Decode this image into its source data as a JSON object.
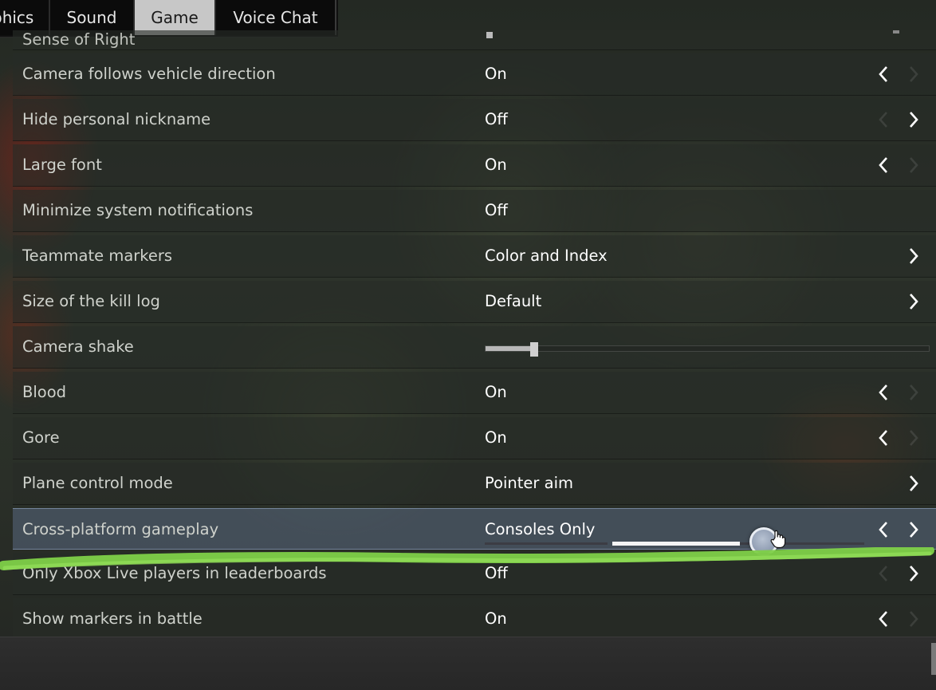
{
  "tabs": [
    {
      "label": "phics"
    },
    {
      "label": "Sound"
    },
    {
      "label": "Game"
    },
    {
      "label": "Voice Chat"
    }
  ],
  "active_tab": "Game",
  "settings": {
    "partial_row": {
      "label": "Sense of Right"
    },
    "rows": [
      {
        "label": "Camera follows vehicle direction",
        "value": "On"
      },
      {
        "label": "Hide personal nickname",
        "value": "Off"
      },
      {
        "label": "Large font",
        "value": "On"
      },
      {
        "label": "Minimize system notifications",
        "value": "Off"
      },
      {
        "label": "Teammate markers",
        "value": "Color and Index"
      },
      {
        "label": "Size of the kill log",
        "value": "Default"
      },
      {
        "label": "Camera shake",
        "value": ""
      },
      {
        "label": "Blood",
        "value": "On"
      },
      {
        "label": "Gore",
        "value": "On"
      },
      {
        "label": "Plane control mode",
        "value": "Pointer aim"
      },
      {
        "label": "Cross-platform gameplay",
        "value": "Consoles Only"
      },
      {
        "label": "Only Xbox Live players in leaderboards",
        "value": "Off"
      },
      {
        "label": "Show markers in battle",
        "value": "On"
      }
    ]
  },
  "camera_shake_level": 0.11,
  "cross_platform_slider_level": 0.6,
  "colors": {
    "active_tab_bg": "#c7c7c7",
    "highlight_row": "#5a6982",
    "marker_green": "#7ed048"
  },
  "icons": {
    "prev": "chevron-left-icon",
    "next": "chevron-right-icon",
    "cursor": "hand-cursor-icon"
  }
}
